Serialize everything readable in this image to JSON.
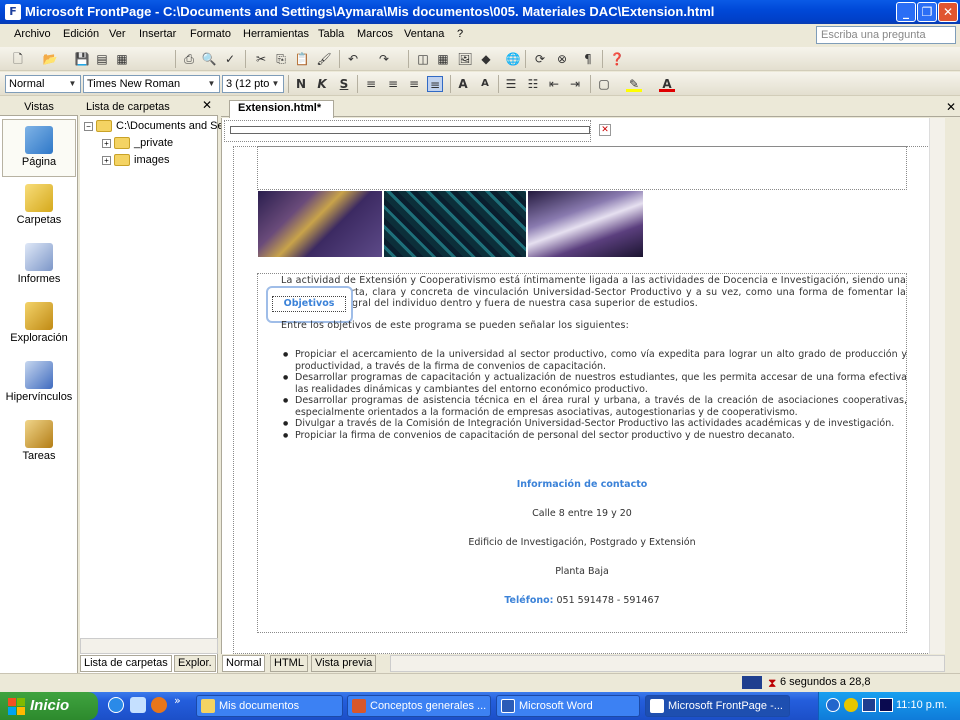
{
  "window": {
    "title": "Microsoft FrontPage - C:\\Documents and Settings\\Aymara\\Mis documentos\\005. Materiales DAC\\Extension.html",
    "app_icon": "frontpage-icon",
    "controls": [
      "minimize",
      "maximize",
      "close"
    ]
  },
  "menu": {
    "items": [
      "Archivo",
      "Edición",
      "Ver",
      "Insertar",
      "Formato",
      "Herramientas",
      "Tabla",
      "Marcos",
      "Ventana",
      "?"
    ],
    "ask_placeholder": "Escriba una pregunta"
  },
  "formatting": {
    "style": "Normal",
    "font": "Times New Roman",
    "size": "3  (12 pto"
  },
  "views": {
    "header": "Vistas",
    "items": [
      {
        "label": "Página",
        "icon": "page-view-icon",
        "active": true
      },
      {
        "label": "Carpetas",
        "icon": "folders-view-icon",
        "active": false
      },
      {
        "label": "Informes",
        "icon": "reports-view-icon",
        "active": false
      },
      {
        "label": "Exploración",
        "icon": "navigation-view-icon",
        "active": false
      },
      {
        "label": "Hipervínculos",
        "icon": "hyperlinks-view-icon",
        "active": false
      },
      {
        "label": "Tareas",
        "icon": "tasks-view-icon",
        "active": false
      }
    ]
  },
  "folder_list": {
    "header": "Lista de carpetas",
    "root": "C:\\Documents and Set",
    "children": [
      "_private",
      "images"
    ]
  },
  "bottom_tabs": {
    "folder_tabs": [
      "Lista de carpetas",
      "Explor."
    ],
    "view_tabs": [
      "Normal",
      "HTML",
      "Vista previa"
    ]
  },
  "document": {
    "tab_label": "Extension.html*",
    "intro": "La actividad de Extensión y Cooperativismo está íntimamente ligada a las actividades de Docencia e Investigación, siendo una actividad abierta, clara y concreta de vinculación Universidad-Sector Productivo y a su vez, como una forma de fomentar la formación integral del individuo dentro y fuera de nuestra casa superior de estudios.",
    "floating_button": "Objetivos",
    "objectives_intro": "Entre los objetivos de este programa se pueden señalar los siguientes:",
    "objectives": [
      "Propiciar el acercamiento de la universidad al sector productivo, como vía expedita para lograr un alto grado de producción y productividad, a través de la firma de convenios de capacitación.",
      "Desarrollar programas de capacitación y actualización de nuestros estudiantes, que les permita accesar de una forma efectiva las realidades dinámicas y cambiantes del entorno económico productivo.",
      "Desarrollar programas de asistencia técnica en el área rural y urbana, a través de la creación de asociaciones cooperativas, especialmente orientados a la formación de empresas asociativas, autogestionarias y de cooperativismo.",
      "Divulgar a través de la Comisión de Integración Universidad-Sector Productivo las actividades académicas y de investigación.",
      "Propiciar la firma de convenios de capacitación de personal del sector productivo y de nuestro  decanato."
    ],
    "contact_heading": "Información de contacto",
    "address": "Calle 8 entre 19 y 20",
    "building": "Edificio de Investigación, Postgrado y Extensión",
    "floor": "Planta Baja",
    "phone_label": "Teléfono:",
    "phone": "051 591478 - 591467"
  },
  "status": {
    "download_time": "6 segundos a 28,8"
  },
  "taskbar": {
    "start": "Inicio",
    "tasks": [
      {
        "label": "Mis documentos",
        "active": false
      },
      {
        "label": "Conceptos generales ...",
        "active": false
      },
      {
        "label": "Microsoft Word",
        "active": false
      },
      {
        "label": "Microsoft FrontPage -...",
        "active": true
      }
    ],
    "clock": "11:10 p.m."
  },
  "colors": {
    "title_bar": "#0a5ae6",
    "link_blue": "#3b82d8",
    "taskbar": "#245edc",
    "start_green": "#3fa33f"
  }
}
